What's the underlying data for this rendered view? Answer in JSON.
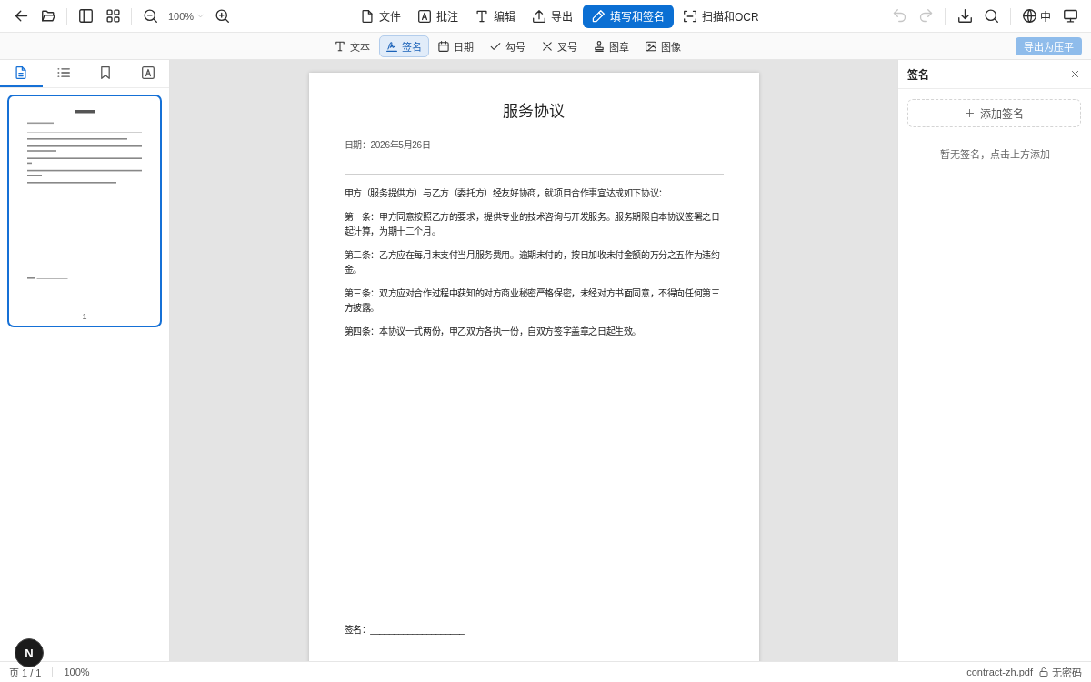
{
  "toolbar": {
    "zoom": "100%",
    "modes": [
      {
        "kind": "file",
        "label": "文件",
        "selected": false
      },
      {
        "kind": "annotate",
        "label": "批注",
        "selected": false
      },
      {
        "kind": "edit",
        "label": "编辑",
        "selected": false
      },
      {
        "kind": "export",
        "label": "导出",
        "selected": false
      },
      {
        "kind": "fill_sign",
        "label": "填写和签名",
        "selected": true
      },
      {
        "kind": "scan",
        "label": "扫描和OCR",
        "selected": false
      }
    ],
    "history": [
      {
        "kind": "undo",
        "disabled": true
      },
      {
        "kind": "redo",
        "disabled": true
      }
    ],
    "language": "中"
  },
  "fill_sign_bar": {
    "tools": [
      {
        "kind": "text",
        "label": "文本",
        "selected": false
      },
      {
        "kind": "signature",
        "label": "签名",
        "selected": true
      },
      {
        "kind": "date",
        "label": "日期",
        "selected": false
      },
      {
        "kind": "check",
        "label": "勾号",
        "selected": false
      },
      {
        "kind": "cross",
        "label": "叉号",
        "selected": false
      },
      {
        "kind": "stamp",
        "label": "图章",
        "selected": false
      },
      {
        "kind": "image",
        "label": "图像",
        "selected": false
      }
    ],
    "export_button": {
      "label": "导出为压平",
      "disabled": true
    }
  },
  "sidebar": {
    "tabs": [
      {
        "kind": "page",
        "selected": true
      },
      {
        "kind": "list",
        "selected": false
      },
      {
        "kind": "bookmark",
        "selected": false
      },
      {
        "kind": "boxed_letter",
        "selected": false
      }
    ],
    "thumbnails": [
      {
        "label": "1",
        "selected": true
      }
    ]
  },
  "document": {
    "title": "服务协议",
    "date_line": "日期：2026年5月26日",
    "paragraphs": [
      "甲方（服务提供方）与乙方（委托方）经友好协商，就项目合作事宜达成如下协议：",
      "第一条：甲方同意按照乙方的要求，提供专业的技术咨询与开发服务。服务期限自本协议签署之日起计算，为期十二个月。",
      "第二条：乙方应在每月末支付当月服务费用。逾期未付的，按日加收未付金额的万分之五作为违约金。",
      "第三条：双方应对合作过程中获知的对方商业秘密严格保密，未经对方书面同意，不得向任何第三方披露。",
      "第四条：本协议一式两份，甲乙双方各执一份，自双方签字盖章之日起生效。"
    ],
    "signature_line": "签名：____________________"
  },
  "signature_panel": {
    "title": "签名",
    "add_button": "添加签名",
    "empty_message": "暂无签名，点击上方添加"
  },
  "status_bar": {
    "page": "页 1 / 1",
    "zoom": "100%",
    "file_name": "contract-zh.pdf",
    "password": "无密码"
  },
  "dev_badge": "N"
}
